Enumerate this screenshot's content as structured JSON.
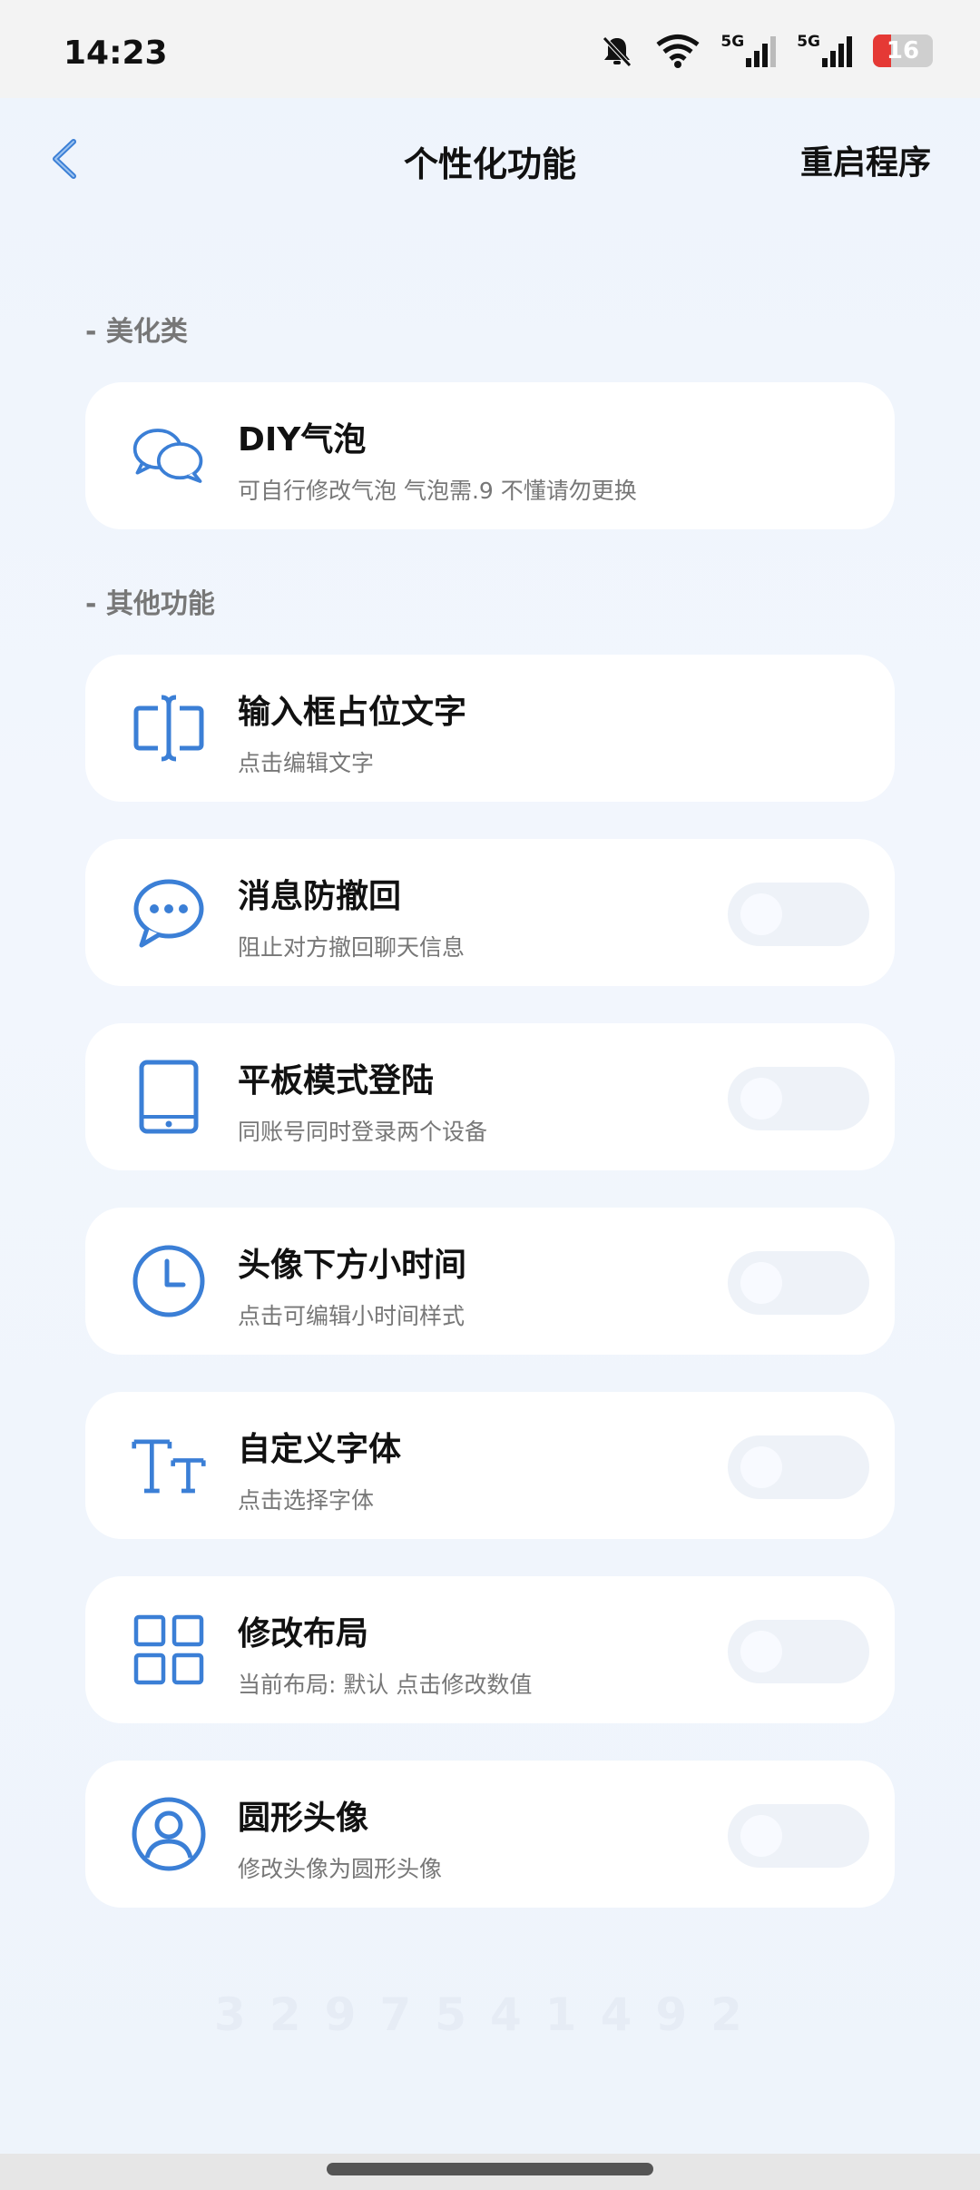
{
  "status_bar": {
    "time": "14:23",
    "battery_level": "16",
    "network_1": "5G",
    "network_2": "5G"
  },
  "header": {
    "title": "个性化功能",
    "action": "重启程序"
  },
  "sections": [
    {
      "label": "- 美化类"
    },
    {
      "label": "- 其他功能"
    }
  ],
  "items": [
    {
      "icon": "chat-bubbles-icon",
      "title": "DIY气泡",
      "subtitle": "可自行修改气泡 气泡需.9 不懂请勿更换"
    },
    {
      "icon": "text-cursor-icon",
      "title": "输入框占位文字",
      "subtitle": "点击编辑文字"
    },
    {
      "icon": "message-dots-icon",
      "title": "消息防撤回",
      "subtitle": "阻止对方撤回聊天信息",
      "toggle_on": false
    },
    {
      "icon": "tablet-icon",
      "title": "平板模式登陆",
      "subtitle": "同账号同时登录两个设备",
      "toggle_on": false
    },
    {
      "icon": "clock-icon",
      "title": "头像下方小时间",
      "subtitle": "点击可编辑小时间样式",
      "toggle_on": false
    },
    {
      "icon": "font-icon",
      "title": "自定义字体",
      "subtitle": "点击选择字体",
      "toggle_on": false
    },
    {
      "icon": "grid-layout-icon",
      "title": "修改布局",
      "subtitle": "当前布局: 默认 点击修改数值",
      "toggle_on": false
    },
    {
      "icon": "round-avatar-icon",
      "title": "圆形头像",
      "subtitle": "修改头像为圆形头像",
      "toggle_on": false
    }
  ],
  "watermark": "3297541492",
  "colors": {
    "accent": "#3b7fd6",
    "battery_low": "#e53935"
  }
}
